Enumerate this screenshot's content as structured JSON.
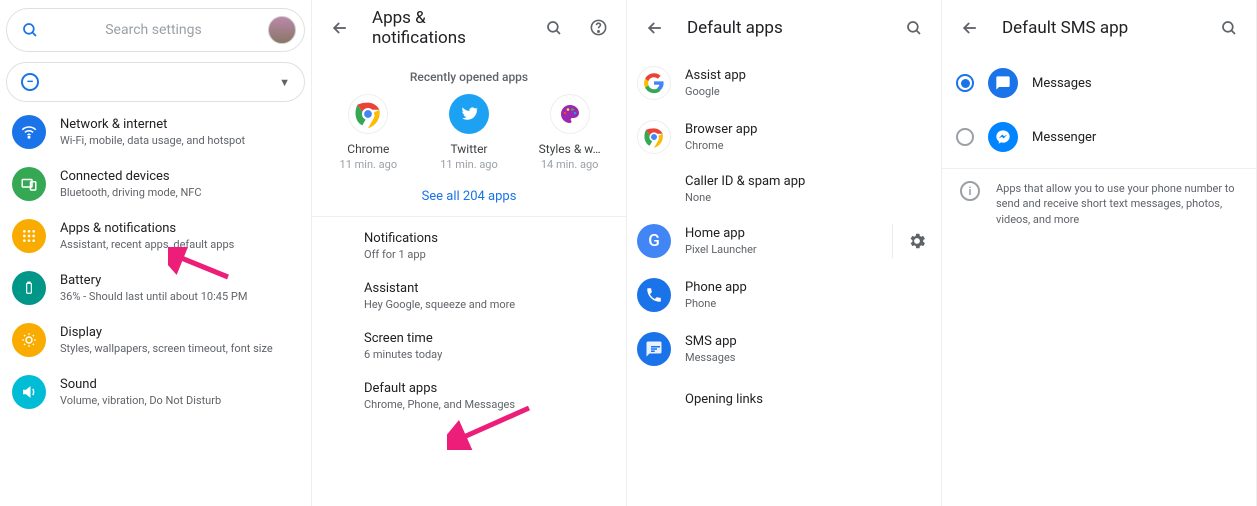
{
  "pane1": {
    "search_placeholder": "Search settings",
    "items": [
      {
        "title": "Network & internet",
        "sub": "Wi-Fi, mobile, data usage, and hotspot"
      },
      {
        "title": "Connected devices",
        "sub": "Bluetooth, driving mode, NFC"
      },
      {
        "title": "Apps & notifications",
        "sub": "Assistant, recent apps, default apps"
      },
      {
        "title": "Battery",
        "sub": "36% - Should last until about 10:45 PM"
      },
      {
        "title": "Display",
        "sub": "Styles, wallpapers, screen timeout, font size"
      },
      {
        "title": "Sound",
        "sub": "Volume, vibration, Do Not Disturb"
      }
    ]
  },
  "pane2": {
    "title": "Apps & notifications",
    "recently_label": "Recently opened apps",
    "recent": [
      {
        "name": "Chrome",
        "time": "11 min. ago"
      },
      {
        "name": "Twitter",
        "time": "11 min. ago"
      },
      {
        "name": "Styles & w…",
        "time": "14 min. ago"
      }
    ],
    "see_all": "See all 204 apps",
    "rows": [
      {
        "title": "Notifications",
        "sub": "Off for 1 app"
      },
      {
        "title": "Assistant",
        "sub": "Hey Google, squeeze and more"
      },
      {
        "title": "Screen time",
        "sub": "6 minutes today"
      },
      {
        "title": "Default apps",
        "sub": "Chrome, Phone, and Messages"
      }
    ]
  },
  "pane3": {
    "title": "Default apps",
    "items": [
      {
        "title": "Assist app",
        "sub": "Google"
      },
      {
        "title": "Browser app",
        "sub": "Chrome"
      },
      {
        "title": "Caller ID & spam app",
        "sub": "None"
      },
      {
        "title": "Home app",
        "sub": "Pixel Launcher",
        "gear": true
      },
      {
        "title": "Phone app",
        "sub": "Phone"
      },
      {
        "title": "SMS app",
        "sub": "Messages"
      },
      {
        "title": "Opening links",
        "sub": ""
      }
    ]
  },
  "pane4": {
    "title": "Default SMS app",
    "options": [
      {
        "label": "Messages",
        "selected": true
      },
      {
        "label": "Messenger",
        "selected": false
      }
    ],
    "info": "Apps that allow you to use your phone number to send and receive short text messages, photos, videos, and more"
  }
}
